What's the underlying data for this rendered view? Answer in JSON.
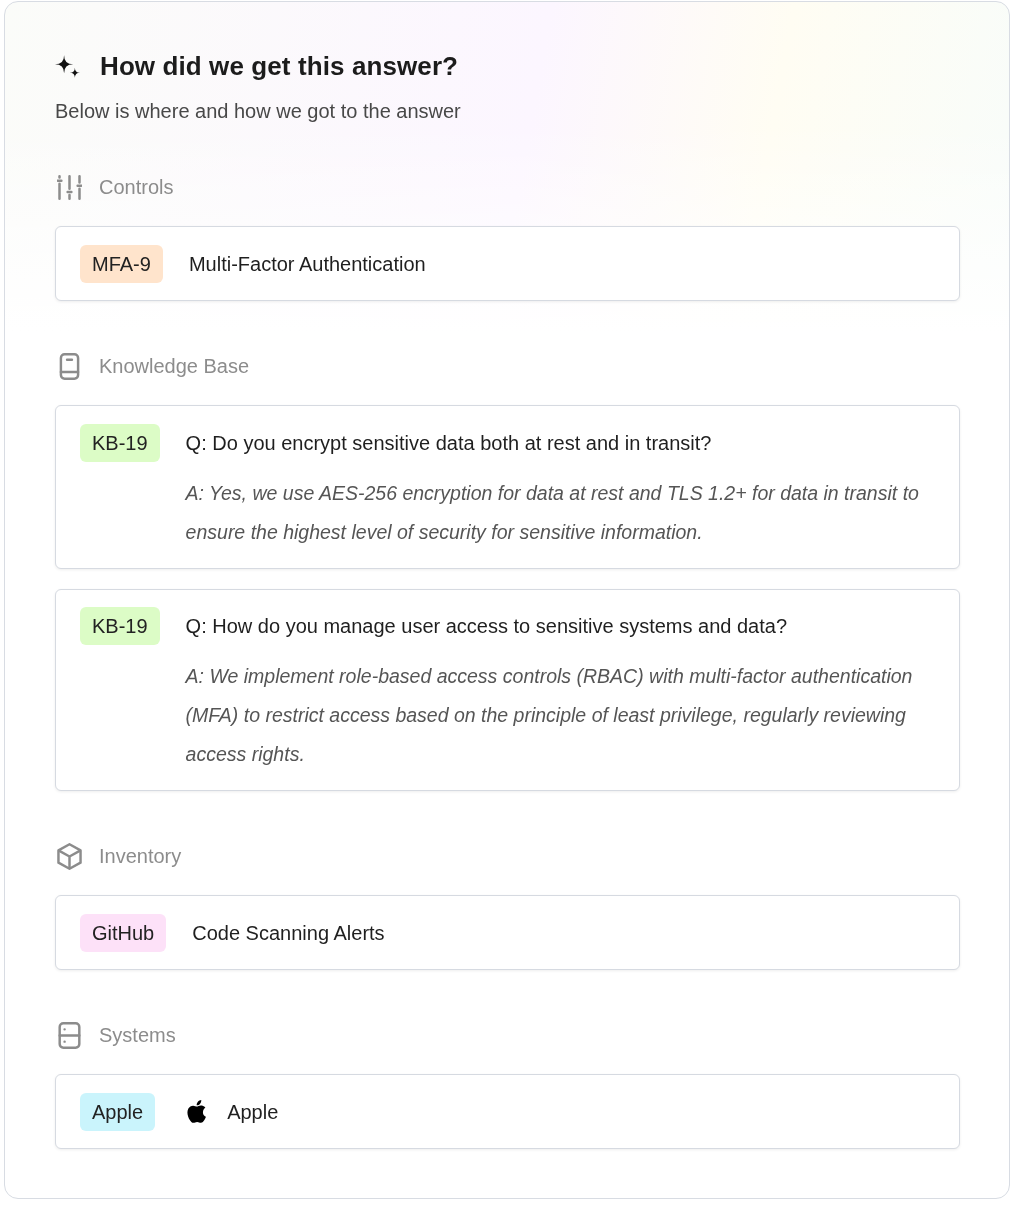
{
  "panel": {
    "title": "How did we get this answer?",
    "subtitle": "Below is where and how we got to the answer"
  },
  "sections": [
    {
      "kind": "controls",
      "label": "Controls",
      "items": [
        {
          "tag": "MFA-9",
          "color": "#ffe4cc",
          "name": "Multi-Factor Authentication"
        }
      ]
    },
    {
      "kind": "knowledge_base",
      "label": "Knowledge Base",
      "items": [
        {
          "tag": "KB-19",
          "color": "#dcfcc6",
          "question": "Q: Do you encrypt sensitive data both at rest and in transit?",
          "answer": "A: Yes, we use AES-256 encryption for data at rest and TLS 1.2+ for data in transit to ensure the highest level of security for sensitive information."
        },
        {
          "tag": "KB-19",
          "color": "#dcfcc6",
          "question": "Q: How do you manage user access to sensitive systems and data?",
          "answer": "A: We implement role-based access controls (RBAC) with multi-factor authentication (MFA) to restrict access based on the principle of least privilege, regularly reviewing access rights."
        }
      ]
    },
    {
      "kind": "inventory",
      "label": "Inventory",
      "items": [
        {
          "tag": "GitHub",
          "color": "#fde1f8",
          "name": "Code Scanning Alerts"
        }
      ]
    },
    {
      "kind": "systems",
      "label": "Systems",
      "items": [
        {
          "tag": "Apple",
          "color": "#caf4fc",
          "name": "Apple"
        }
      ]
    }
  ]
}
